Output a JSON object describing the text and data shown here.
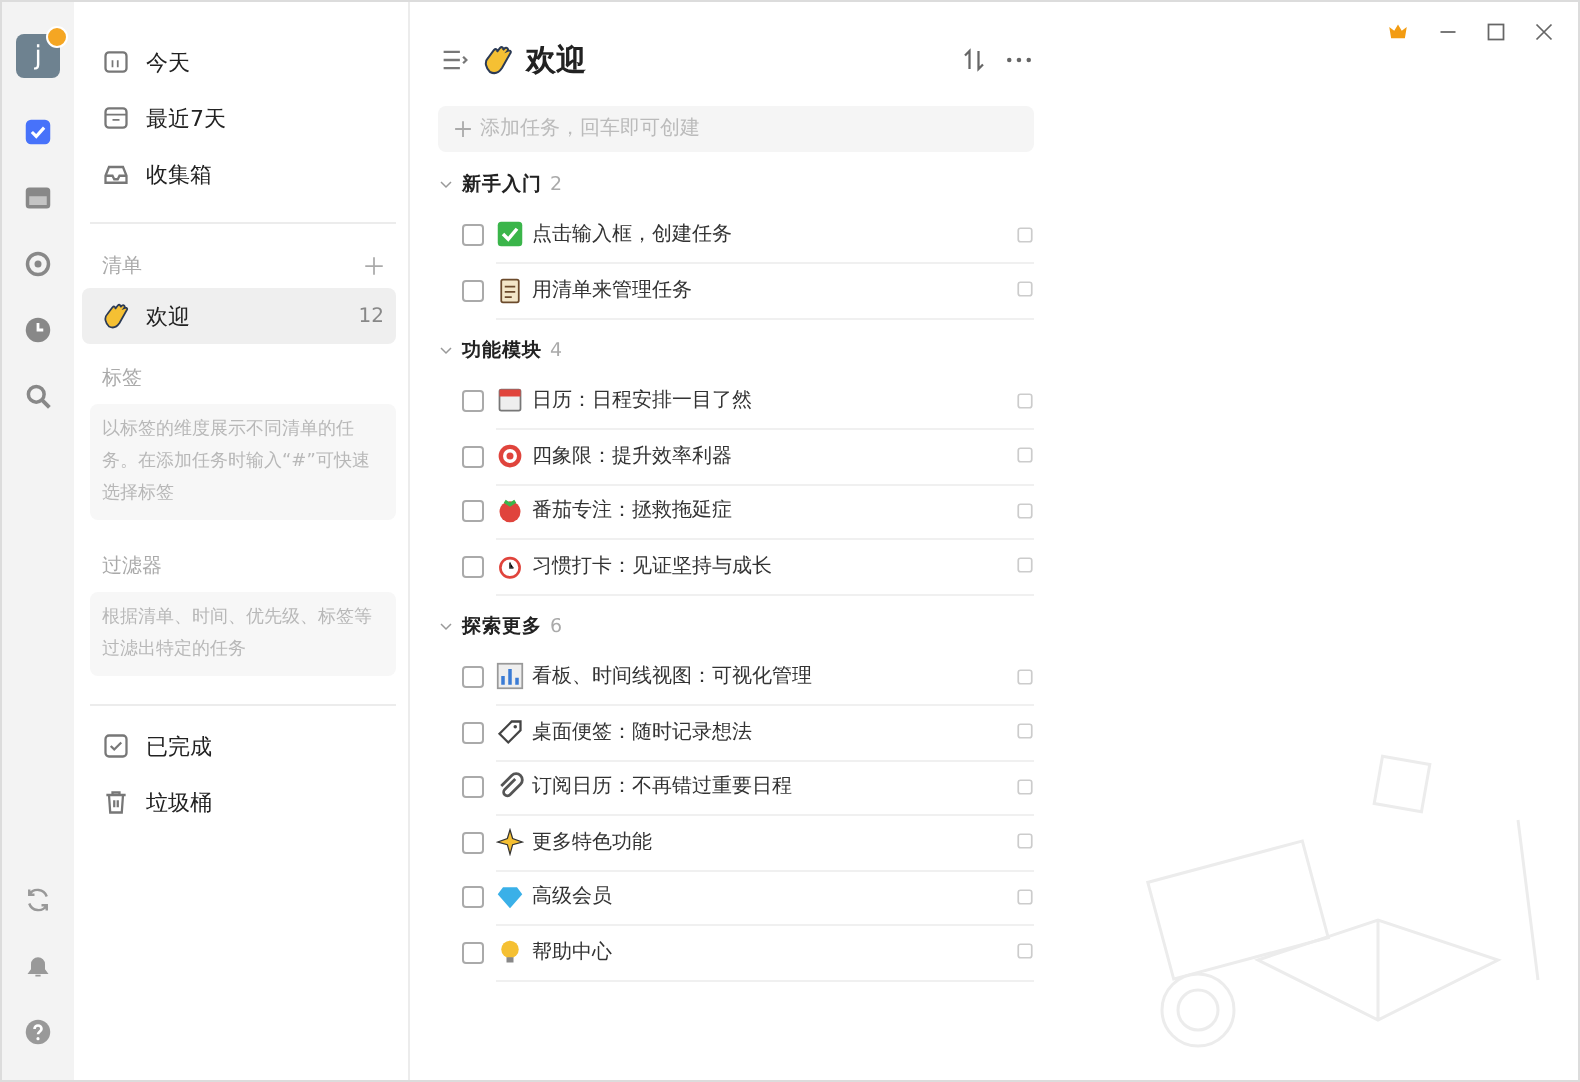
{
  "rail": {
    "avatar": "j",
    "items": [
      {
        "kind": "tasks",
        "selected": true
      },
      {
        "kind": "calendar",
        "selected": false
      },
      {
        "kind": "focus",
        "selected": false
      },
      {
        "kind": "habit",
        "selected": false
      },
      {
        "kind": "search",
        "selected": false
      }
    ]
  },
  "sidebar": {
    "smart_lists": [
      {
        "kind": "today",
        "label": "今天"
      },
      {
        "kind": "week",
        "label": "最近7天"
      },
      {
        "kind": "inbox",
        "label": "收集箱"
      }
    ],
    "lists_header": "清单",
    "lists": [
      {
        "label": "欢迎",
        "count": "12",
        "selected": true
      }
    ],
    "tags_header": "标签",
    "tags_hint": "以标签的维度展示不同清单的任务。在添加任务时输入“#”可快速选择标签",
    "filters_header": "过滤器",
    "filters_hint": "根据清单、时间、优先级、标签等过滤出特定的任务",
    "bottom": [
      {
        "kind": "completed",
        "label": "已完成"
      },
      {
        "kind": "trash",
        "label": "垃圾桶"
      }
    ]
  },
  "main": {
    "title": "欢迎",
    "add_placeholder": "添加任务，回车即可创建",
    "groups": [
      {
        "title": "新手入门",
        "count": "2",
        "expanded": true,
        "tasks": [
          {
            "title": "点击输入框，创建任务",
            "checked": false
          },
          {
            "title": "用清单来管理任务",
            "checked": false
          }
        ]
      },
      {
        "title": "功能模块",
        "count": "4",
        "expanded": true,
        "tasks": [
          {
            "title": "日历：日程安排一目了然",
            "checked": false
          },
          {
            "title": "四象限：提升效率利器",
            "checked": false
          },
          {
            "title": "番茄专注：拯救拖延症",
            "checked": false
          },
          {
            "title": "习惯打卡：见证坚持与成长",
            "checked": false
          }
        ]
      },
      {
        "title": "探索更多",
        "count": "6",
        "expanded": true,
        "tasks": [
          {
            "title": "看板、时间线视图：可视化管理",
            "checked": false
          },
          {
            "title": "桌面便签：随时记录想法",
            "checked": false
          },
          {
            "title": "订阅日历：不再错过重要日程",
            "checked": false
          },
          {
            "title": "更多特色功能",
            "checked": false
          },
          {
            "title": "高级会员",
            "checked": false
          },
          {
            "title": "帮助中心",
            "checked": false
          }
        ]
      }
    ]
  }
}
